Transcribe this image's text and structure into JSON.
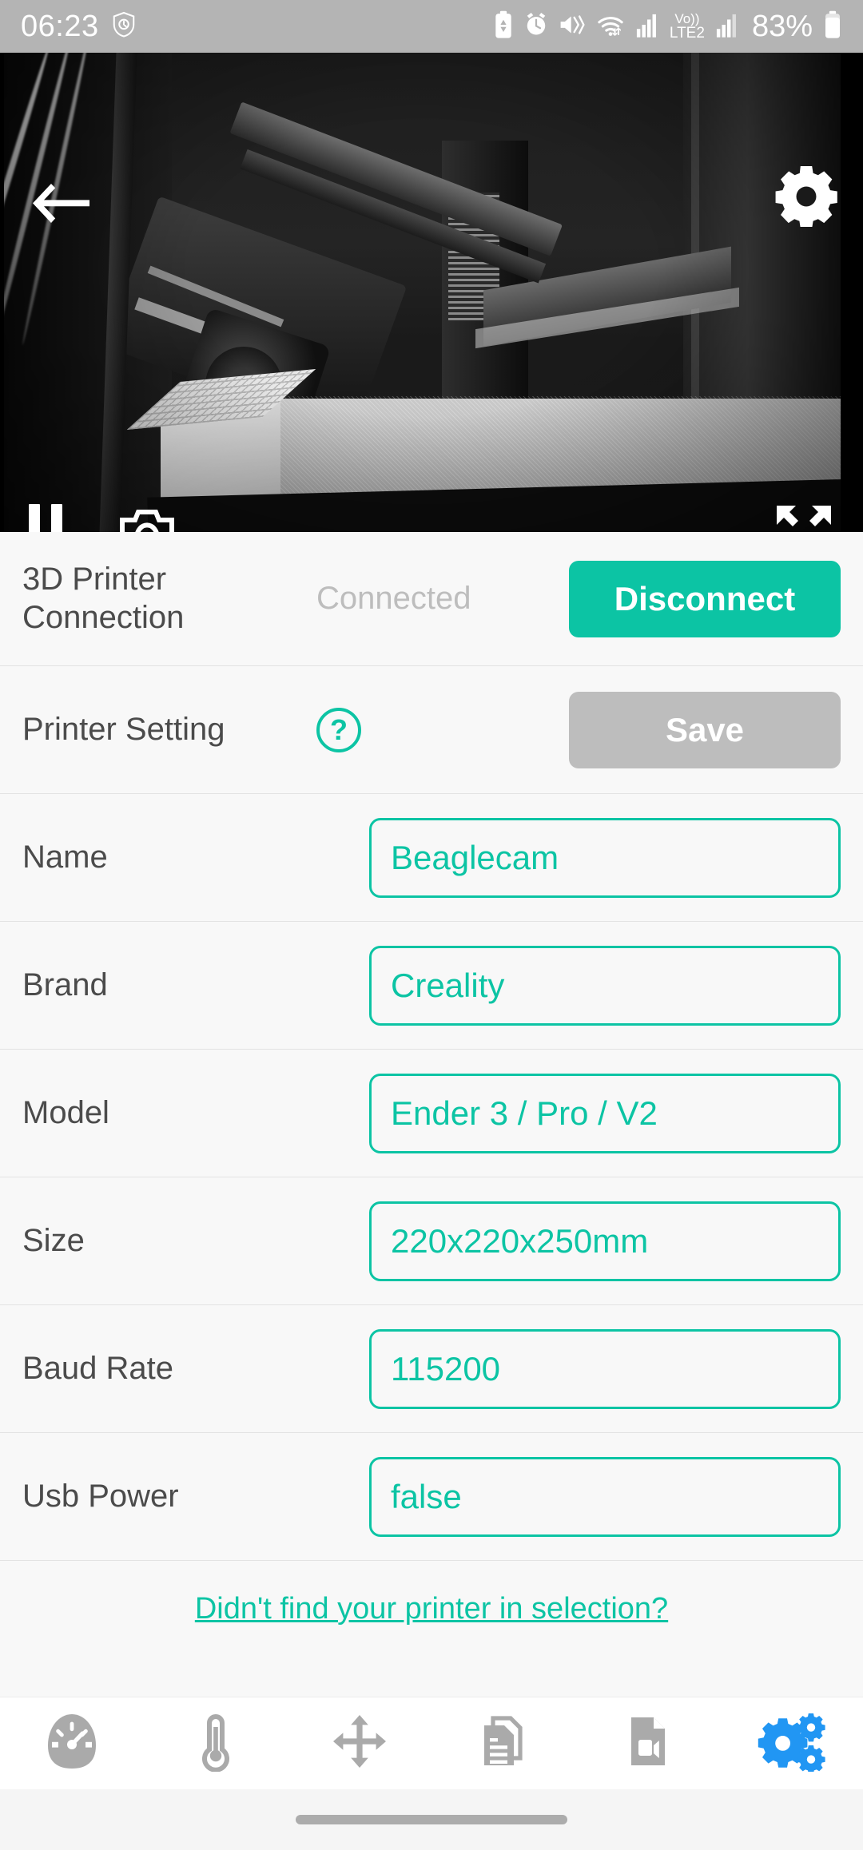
{
  "statusbar": {
    "time": "06:23",
    "battery_percent": "83%",
    "network_label": "LTE2",
    "volte_label": "Vo))",
    "icons": [
      "shield-clock-icon",
      "battery-saver-icon",
      "alarm-icon",
      "mute-vibrate-icon",
      "wifi-icon",
      "signal-icon",
      "volte-icon",
      "signal2-icon",
      "battery-icon"
    ]
  },
  "video": {
    "back_label": "back-arrow",
    "settings_label": "gear",
    "pause_label": "pause",
    "snapshot_label": "camera",
    "fullscreen_label": "expand"
  },
  "connection": {
    "label": "3D Printer\nConnection",
    "label_line1": "3D Printer",
    "label_line2": "Connection",
    "status": "Connected",
    "button": "Disconnect"
  },
  "printer_setting": {
    "label": "Printer Setting",
    "help": "?",
    "button": "Save"
  },
  "fields": [
    {
      "label": "Name",
      "value": "Beaglecam"
    },
    {
      "label": "Brand",
      "value": "Creality"
    },
    {
      "label": "Model",
      "value": "Ender 3 / Pro / V2"
    },
    {
      "label": "Size",
      "value": "220x220x250mm"
    },
    {
      "label": "Baud Rate",
      "value": "115200"
    },
    {
      "label": "Usb Power",
      "value": "false"
    }
  ],
  "footer_link": "Didn't find your printer in selection?",
  "bottomnav": {
    "items": [
      {
        "name": "dashboard",
        "icon": "gauge-icon",
        "active": false
      },
      {
        "name": "temperature",
        "icon": "thermometer-icon",
        "active": false
      },
      {
        "name": "move",
        "icon": "move-arrows-icon",
        "active": false
      },
      {
        "name": "files",
        "icon": "documents-icon",
        "active": false
      },
      {
        "name": "video",
        "icon": "video-file-icon",
        "active": false
      },
      {
        "name": "settings",
        "icon": "gears-icon",
        "active": true
      }
    ]
  },
  "colors": {
    "accent": "#0cc4a4",
    "nav_active": "#2196F3",
    "nav_inactive": "#aaaaaa",
    "statusbar_bg": "#b4b4b4",
    "disabled_button": "#bdbdbd"
  }
}
